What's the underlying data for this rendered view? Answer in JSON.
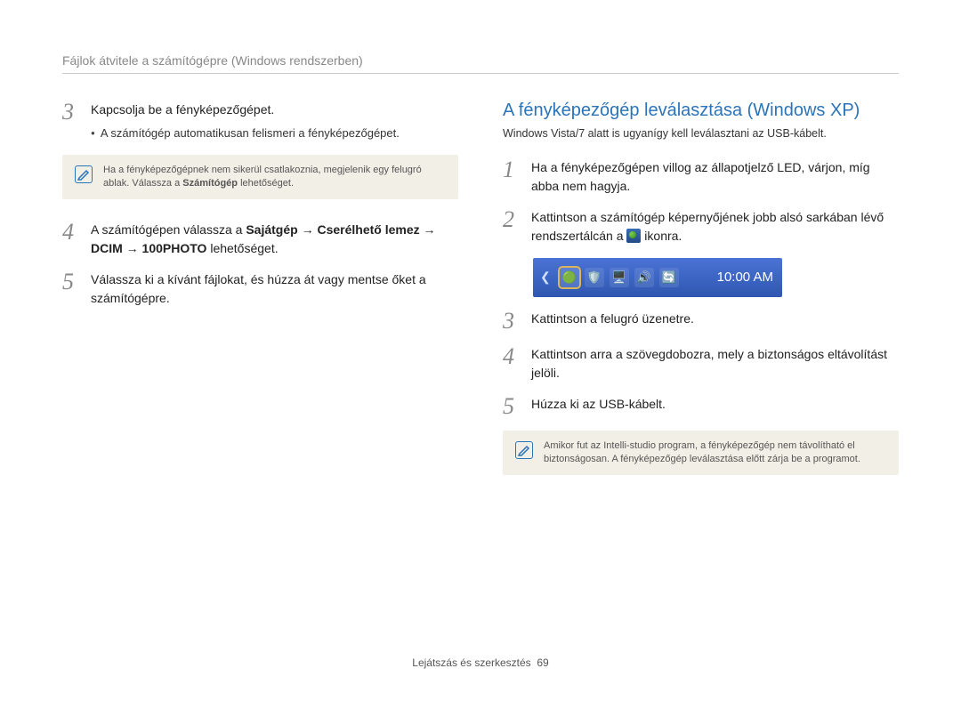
{
  "header": "Fájlok átvitele a számítógépre (Windows rendszerben)",
  "left": {
    "step3": {
      "num": "3",
      "text": "Kapcsolja be a fényképezőgépet.",
      "sub": "A számítógép automatikusan felismeri a fényképezőgépet."
    },
    "note_a": "Ha a fényképezőgépnek nem sikerül csatlakoznia, megjelenik egy felugró ablak. Válassza a ",
    "note_b": "Számítógép",
    "note_c": " lehetőséget.",
    "step4": {
      "num": "4",
      "pre": "A számítógépen válassza a ",
      "bold": "Sajátgép → Cserélhető lemez → DCIM → 100PHOTO",
      "post": " lehetőséget."
    },
    "step5": {
      "num": "5",
      "text": "Válassza ki a kívánt fájlokat, és húzza át vagy mentse őket a számítógépre."
    }
  },
  "right": {
    "title": "A fényképezőgép leválasztása (Windows XP)",
    "subtitle": "Windows Vista/7 alatt is ugyanígy kell leválasztani az USB-kábelt.",
    "step1": {
      "num": "1",
      "text": "Ha a fényképezőgépen villog az állapotjelző LED, várjon, míg abba nem hagyja."
    },
    "step2": {
      "num": "2",
      "pre": "Kattintson a számítógép képernyőjének jobb alsó sarkában lévő rendszertálcán a ",
      "post": " ikonra."
    },
    "clock": "10:00 AM",
    "step3": {
      "num": "3",
      "text": "Kattintson a felugró üzenetre."
    },
    "step4": {
      "num": "4",
      "text": "Kattintson arra a szövegdobozra, mely a biztonságos eltávolítást jelöli."
    },
    "step5": {
      "num": "5",
      "text": "Húzza ki az USB-kábelt."
    },
    "note": "Amikor fut az Intelli-studio program, a fényképezőgép nem távolítható el biztonságosan. A fényképezőgép leválasztása előtt zárja be a programot."
  },
  "footer": {
    "section": "Lejátszás és szerkesztés",
    "page": "69"
  }
}
